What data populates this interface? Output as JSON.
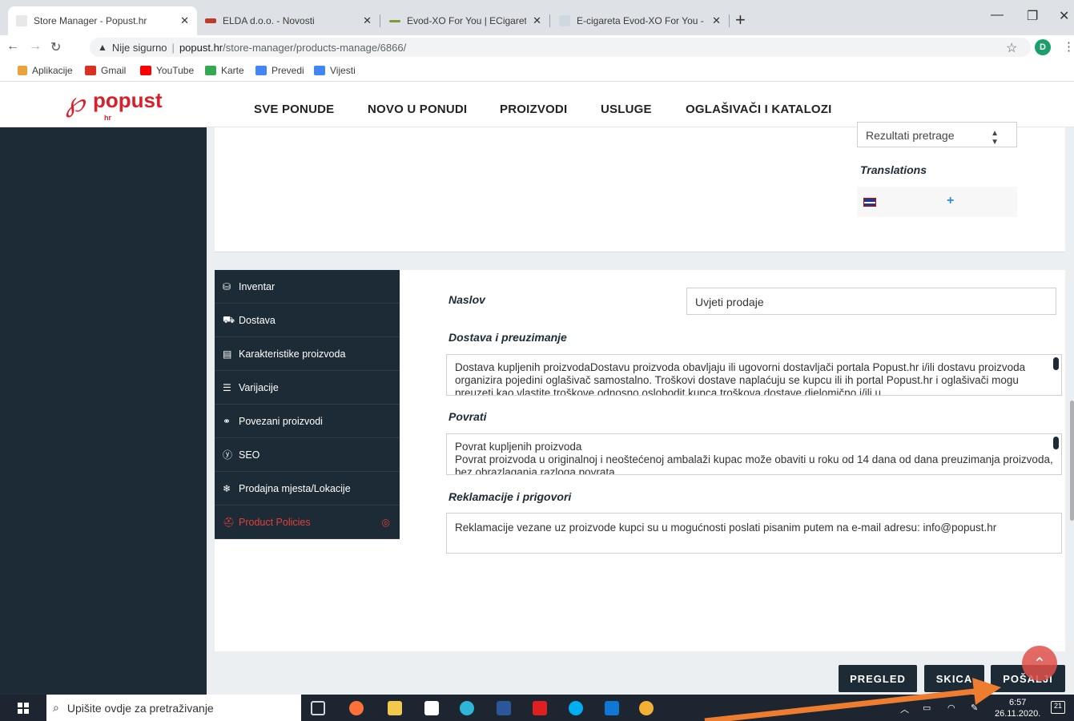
{
  "browser": {
    "tabs": [
      {
        "title": "Store Manager - Popust.hr",
        "favicon_color": "#e8e8e8"
      },
      {
        "title": "ELDA d.o.o. - Novosti",
        "favicon_color": "#c0392b"
      },
      {
        "title": "Evod-XO For You | ECigareta Sho",
        "favicon_color": "#7e9a3a"
      },
      {
        "title": "E-cigareta Evod-XO For You - Po",
        "favicon_color": "#cfd8e0"
      }
    ],
    "new_tab": "+",
    "url_warning": "Nije sigurno",
    "url_host": "popust.hr",
    "url_path": "/store-manager/products-manage/6866/",
    "profile_initial": "D",
    "bookmarks": [
      {
        "label": "Aplikacije",
        "color": "#e8a33d"
      },
      {
        "label": "Gmail",
        "color": "#d93025"
      },
      {
        "label": "YouTube",
        "color": "#ff0000"
      },
      {
        "label": "Karte",
        "color": "#34a853"
      },
      {
        "label": "Prevedi",
        "color": "#4285f4"
      },
      {
        "label": "Vijesti",
        "color": "#4285f4"
      }
    ]
  },
  "site": {
    "logo_word": "popust",
    "logo_suffix": "hr",
    "nav": [
      "SVE PONUDE",
      "NOVO U PONUDI",
      "PROIZVODI",
      "USLUGE",
      "OGLAŠIVAČI I KATALOZI"
    ]
  },
  "top_panel": {
    "select_value": "Rezultati pretrage",
    "translations_label": "Translations",
    "add_symbol": "+"
  },
  "menu": [
    {
      "label": "Inventar",
      "icon": "database-icon",
      "glyph": "⛁"
    },
    {
      "label": "Dostava",
      "icon": "truck-icon",
      "glyph": "⛟"
    },
    {
      "label": "Karakteristike proizvoda",
      "icon": "list-icon",
      "glyph": "▤"
    },
    {
      "label": "Varijacije",
      "icon": "tasks-icon",
      "glyph": "☰"
    },
    {
      "label": "Povezani proizvodi",
      "icon": "link-icon",
      "glyph": "⚭"
    },
    {
      "label": "SEO",
      "icon": "yoast-icon",
      "glyph": "ⓨ"
    },
    {
      "label": "Prodajna mjesta/Lokacije",
      "icon": "snowflake-icon",
      "glyph": "❄"
    },
    {
      "label": "Product Policies",
      "icon": "ambulance-icon",
      "glyph": "⛑",
      "active": true
    }
  ],
  "policies": {
    "naslov_label": "Naslov",
    "naslov_value": "Uvjeti prodaje",
    "dostava_label": "Dostava i preuzimanje",
    "dostava_text": "Dostava kupljenih proizvodaDostavu proizvoda obavljaju ili ugovorni dostavljači portala Popust.hr i/ili dostavu proizvoda organizira pojedini oglašivač samostalno. Troškovi dostave naplaćuju se kupcu ili ih portal Popust.hr i oglašivači mogu preuzeti kao vlastite troškove odnosno oslobodit kupca troškova dostave djelomično i/ili u",
    "povrati_label": "Povrati",
    "povrati_line1": "Povrat kupljenih proizvoda",
    "povrati_line2": "Povrat proizvoda u originalnoj i neoštećenoj ambalaži kupac može obaviti u roku od 14 dana od dana preuzimanja proizvoda, bez obrazlaganja razloga povrata",
    "reklamacije_label": "Reklamacije i prigovori",
    "reklamacije_text": "Reklamacije vezane uz proizvode kupci su u mogućnosti poslati pisanim putem na e-mail adresu: info@popust.hr"
  },
  "actions": {
    "preview": "PREGLED",
    "draft": "SKICA",
    "submit": "POŠALJI"
  },
  "taskbar": {
    "search_placeholder": "Upišite ovdje za pretraživanje",
    "time": "6:57",
    "date": "26.11.2020.",
    "notifications": "21",
    "app_icons": [
      {
        "name": "task-view-icon",
        "color": "#cfd8dc"
      },
      {
        "name": "firefox-icon",
        "color": "#ff7139"
      },
      {
        "name": "file-explorer-icon",
        "color": "#f2c94c"
      },
      {
        "name": "store-icon",
        "color": "#ffffff"
      },
      {
        "name": "edge-icon",
        "color": "#2fb5d8"
      },
      {
        "name": "word-icon",
        "color": "#2b579a"
      },
      {
        "name": "acrobat-icon",
        "color": "#e02020"
      },
      {
        "name": "skype-icon",
        "color": "#00aff0"
      },
      {
        "name": "outlook-icon",
        "color": "#0f78d4"
      },
      {
        "name": "chrome-icon",
        "color": "#f2b134"
      }
    ]
  },
  "colors": {
    "dark": "#1d2b36",
    "brand_red": "#d81f2a",
    "active_menu": "#e0403a",
    "annotation_arrow": "#ef7d2f"
  }
}
